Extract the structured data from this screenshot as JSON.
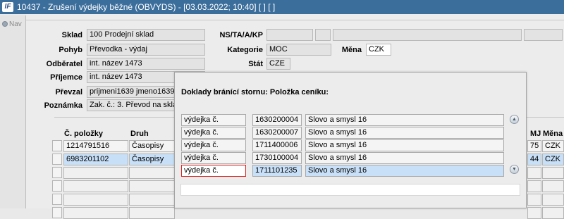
{
  "window": {
    "app_icon_text": "IF",
    "title": "10437 - Zrušení výdejky běžné (OBVYDS) - [03.03.2022; 10:40]  [ ]  [ ]"
  },
  "nav": {
    "label": "Nav"
  },
  "form": {
    "sklad": {
      "label": "Sklad",
      "value": "100 Prodejní sklad"
    },
    "pohyb": {
      "label": "Pohyb",
      "value": "Převodka - výdaj"
    },
    "odberatel": {
      "label": "Odběratel",
      "value": "int. název 1473"
    },
    "prijemce": {
      "label": "Příjemce",
      "value": "int. název 1473"
    },
    "prevzal": {
      "label": "Převzal",
      "value": "prijmeni1639 jmeno1639 pi"
    },
    "poznamka": {
      "label": "Poznámka",
      "value": "Zak. č.: 3. Převod na sklad"
    },
    "ns": {
      "label": "NS/TA/A/KP",
      "values": [
        "",
        "",
        "",
        ""
      ]
    },
    "kategorie": {
      "label": "Kategorie",
      "value": "MOC"
    },
    "mena": {
      "label": "Měna",
      "value": "CZK"
    },
    "stat": {
      "label": "Stát",
      "value": "CZE"
    }
  },
  "grid": {
    "headers": {
      "cislo": "Č. položky",
      "druh": "Druh",
      "mj": "MJ",
      "mena": "Měna"
    },
    "rows": [
      {
        "cislo": "1214791516",
        "druh": "Časopisy",
        "mj": "75",
        "mena": "CZK"
      },
      {
        "cislo": "6983201102",
        "druh": "Časopisy",
        "mj": "44",
        "mena": "CZK"
      },
      {
        "cislo": "",
        "druh": "",
        "mj": "",
        "mena": ""
      },
      {
        "cislo": "",
        "druh": "",
        "mj": "",
        "mena": ""
      },
      {
        "cislo": "",
        "druh": "",
        "mj": "",
        "mena": ""
      },
      {
        "cislo": "",
        "druh": "",
        "mj": "",
        "mena": ""
      }
    ]
  },
  "popup": {
    "title": "Doklady bránící stornu: Položka ceníku:",
    "rows": [
      {
        "typ": "výdejka č.",
        "cislo": "1630200004",
        "text": "Slovo a smysl 16"
      },
      {
        "typ": "výdejka č.",
        "cislo": "1630200007",
        "text": "Slovo a smysl 16"
      },
      {
        "typ": "výdejka č.",
        "cislo": "1711400006",
        "text": "Slovo a smysl 16"
      },
      {
        "typ": "výdejka č.",
        "cislo": "1730100004",
        "text": "Slovo a smysl 16"
      },
      {
        "typ": "výdejka č.",
        "cislo": "1711101235",
        "text": "Slovo a smysl 16"
      }
    ],
    "scroll_up_icon": "▲",
    "scroll_down_icon": "▼"
  },
  "colors": {
    "titlebar": "#3c6e9c",
    "selection": "#c9e1f8",
    "focus_border": "#dd2222"
  }
}
